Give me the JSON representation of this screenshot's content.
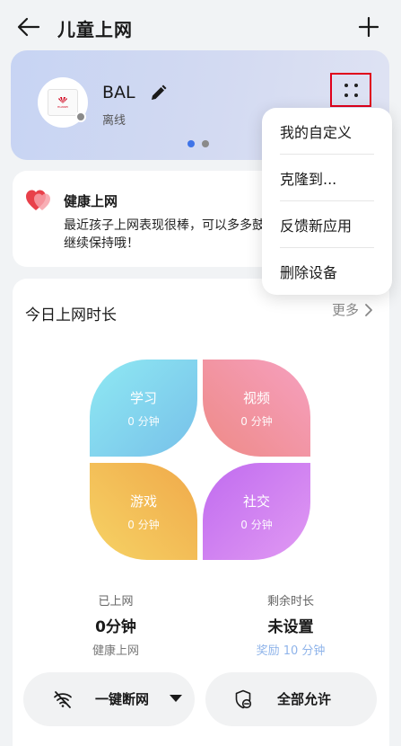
{
  "header": {
    "title": "儿童上网"
  },
  "device": {
    "name": "BAL",
    "status": "离线"
  },
  "health": {
    "title": "健康上网",
    "text": "最近孩子上网表现很棒，可以多多鼓励继续保持哦！"
  },
  "popup_menu": {
    "items": [
      {
        "label": "我的自定义"
      },
      {
        "label": "克隆到..."
      },
      {
        "label": "反馈新应用"
      },
      {
        "label": "删除设备"
      }
    ]
  },
  "usage": {
    "title": "今日上网时长",
    "more_label": "更多",
    "categories": [
      {
        "name": "学习",
        "value": "0 分钟"
      },
      {
        "name": "视频",
        "value": "0 分钟"
      },
      {
        "name": "游戏",
        "value": "0 分钟"
      },
      {
        "name": "社交",
        "value": "0 分钟"
      }
    ],
    "online": {
      "label": "已上网",
      "value": "0分钟",
      "sub": "健康上网"
    },
    "remaining": {
      "label": "剩余时长",
      "value": "未设置",
      "sub": "奖励 10 分钟"
    }
  },
  "actions": {
    "disconnect_label": "一键断网",
    "allow_label": "全部允许"
  },
  "colors": {
    "accent_red": "#e0001b",
    "page_dot_active": "#3f74e8",
    "page_dot_inactive": "#8a8a8a",
    "heart": "#e8404a"
  }
}
